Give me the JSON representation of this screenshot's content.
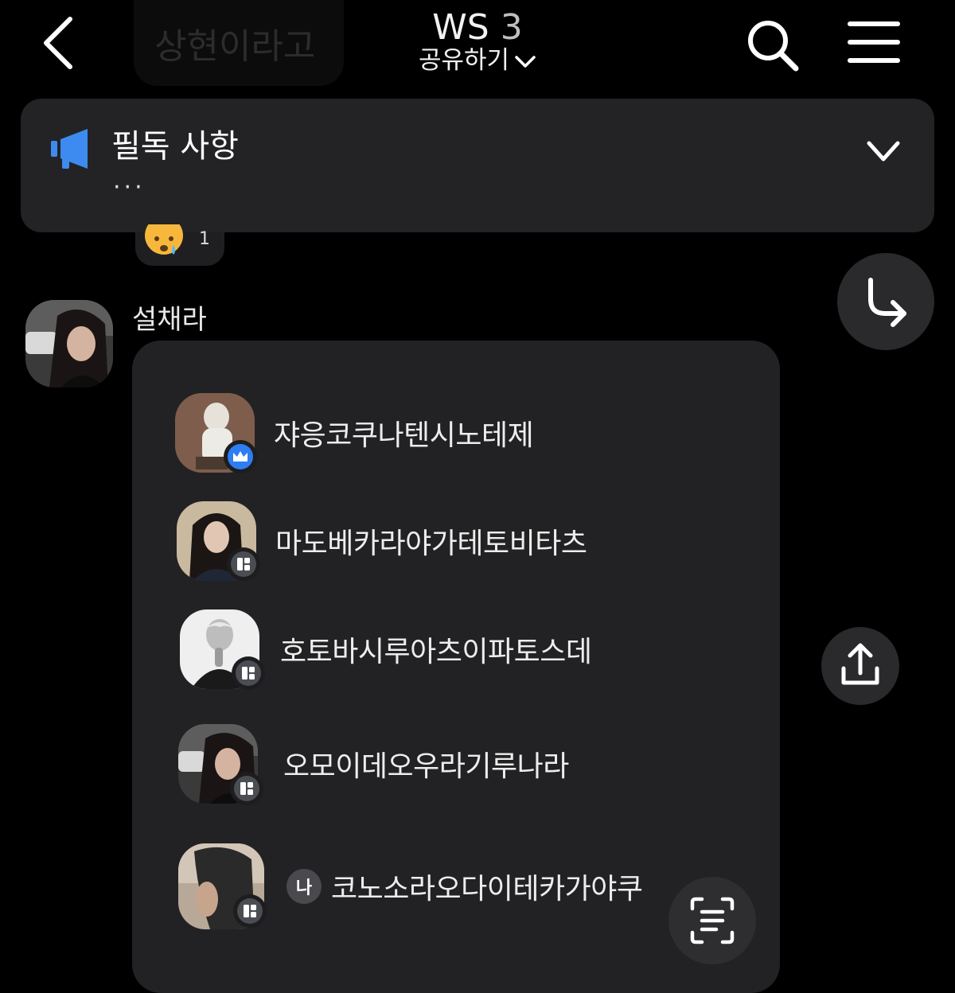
{
  "header": {
    "title": "WS",
    "member_count": "3",
    "subtitle": "공유하기",
    "ghost_text": "상현이라고"
  },
  "notice": {
    "title": "필독 사항",
    "preview": "···",
    "icon_color": "#3d8bf0"
  },
  "reaction": {
    "count": "1"
  },
  "message": {
    "sender": "설채라",
    "members": [
      {
        "name": "쟈응코쿠나텐시노테제",
        "badge": "crown",
        "role": "host"
      },
      {
        "name": "마도베카라야가테토비타츠",
        "badge": "member"
      },
      {
        "name": "호토바시루아츠이파토스데",
        "badge": "member"
      },
      {
        "name": "오모이데오우라기루나라",
        "badge": "member"
      },
      {
        "name": "코노소라오다이테카가야쿠",
        "badge": "member",
        "me_tag": "나"
      }
    ]
  },
  "colors": {
    "background": "#000000",
    "surface": "#232325",
    "card": "#222224",
    "accent": "#2f7df2"
  }
}
